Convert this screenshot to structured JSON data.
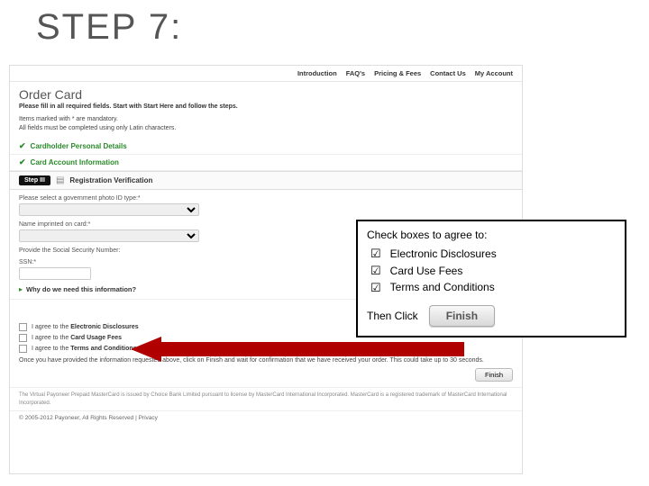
{
  "slide": {
    "title": "STEP 7:"
  },
  "nav": {
    "items": [
      "Introduction",
      "FAQ's",
      "Pricing & Fees",
      "Contact Us",
      "My Account"
    ]
  },
  "page": {
    "title": "Order Card",
    "intro": "Please fill in all required fields. Start with Start Here and follow the steps.",
    "note1": "Items marked with * are mandatory.",
    "note2": "All fields must be completed using only Latin characters."
  },
  "sections": {
    "s1": "Cardholder Personal Details",
    "s2": "Card Account Information"
  },
  "step": {
    "badge": "Step III",
    "label": "Registration Verification"
  },
  "form": {
    "row1_label": "Please select a government photo ID type:*",
    "row2_label": "Name imprinted on card:*",
    "row3_label": "Provide the Social Security Number:",
    "row4_label": "SSN:*",
    "help": "Why do we need this information?"
  },
  "agree": {
    "r1a": "I agree to the ",
    "r1b": "Electronic Disclosures",
    "r2a": "I agree to the ",
    "r2b": "Card Usage Fees",
    "r3a": "I agree to the ",
    "r3b": "Terms and Conditions",
    "note": "Once you have provided the information requested above, click on Finish and wait for confirmation that we have received your order. This could take up to 30 seconds.",
    "finish": "Finish"
  },
  "legal": "The Virtual Payoneer Prepaid MasterCard is issued by Choice Bank Limited pursuant to license by MasterCard International Incorporated. MasterCard is a registered trademark of MasterCard International Incorporated.",
  "footer": "© 2005-2012 Payoneer, All Rights Reserved | Privacy",
  "callout": {
    "title": "Check boxes to agree to:",
    "items": [
      "Electronic Disclosures",
      "Card Use Fees",
      "Terms and Conditions"
    ],
    "then": "Then Click",
    "finish": "Finish"
  }
}
